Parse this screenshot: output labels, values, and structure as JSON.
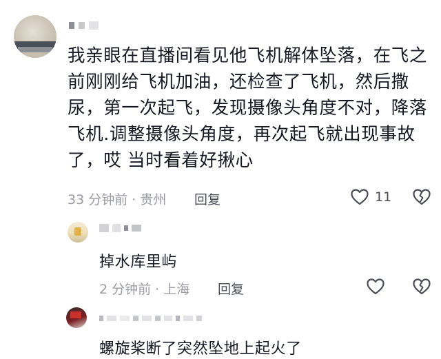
{
  "comment": {
    "text_lines": [
      "我亲眼在直播间看见他飞机解体坠落，在飞之",
      "前刚刚给飞机加油，还检查了飞机，然后撒",
      "尿，第一次起飞，发现摄像头角度不对，降落",
      "飞机.调整摄像头角度，再次起飞就出现事故",
      "了，哎  当时看着好揪心"
    ],
    "time_location": "33 分钟前 · 贵州",
    "reply_label": "回复",
    "like_count": "11",
    "icons": {
      "like": "heart-outline-icon",
      "dislike": "broken-heart-icon"
    }
  },
  "replies": [
    {
      "text": "掉水库里屿",
      "time_location": "2 分钟前 · 上海",
      "reply_label": "回复"
    },
    {
      "text": "螺旋桨断了突然坠地上起火了"
    }
  ],
  "colors": {
    "text": "#161823",
    "meta": "#9a9ba2",
    "reply": "#4b4d56",
    "background": "#ffffff"
  }
}
